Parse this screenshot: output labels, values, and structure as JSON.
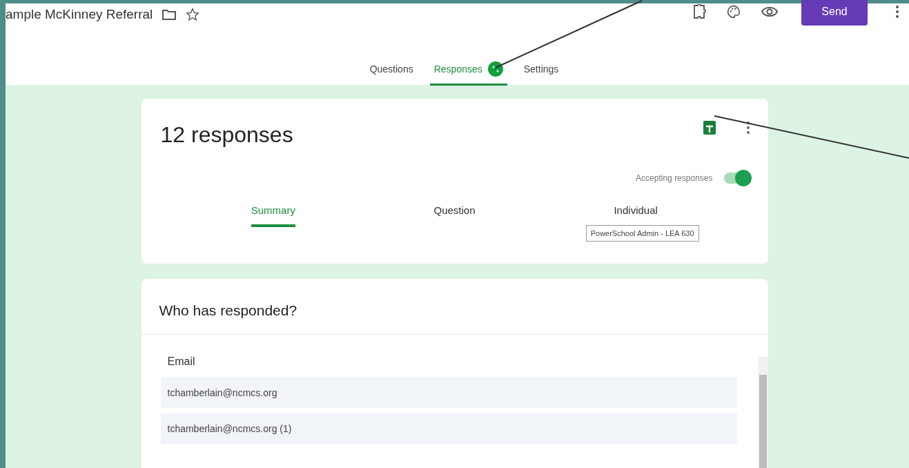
{
  "header": {
    "title": "ample McKinney Referral",
    "send_button": "Send"
  },
  "tabs": [
    {
      "label": "Questions",
      "selected": false,
      "badge": false
    },
    {
      "label": "Responses",
      "selected": true,
      "badge": true
    },
    {
      "label": "Settings",
      "selected": false,
      "badge": false
    }
  ],
  "responses_card": {
    "count": "12 responses",
    "accepting_label": "Accepting responses",
    "accepting": {
      "on": true
    },
    "tabs": [
      {
        "label": "Summary",
        "selected": true
      },
      {
        "label": "Question",
        "selected": false
      },
      {
        "label": "Individual",
        "selected": false
      }
    ],
    "tooltip": "PowerSchool Admin - LEA 630"
  },
  "who_card": {
    "title": "Who has responded?",
    "column": "Email",
    "rows": [
      "tchamberlain@ncmcs.org",
      "tchamberlain@ncmcs.org (1)"
    ]
  }
}
